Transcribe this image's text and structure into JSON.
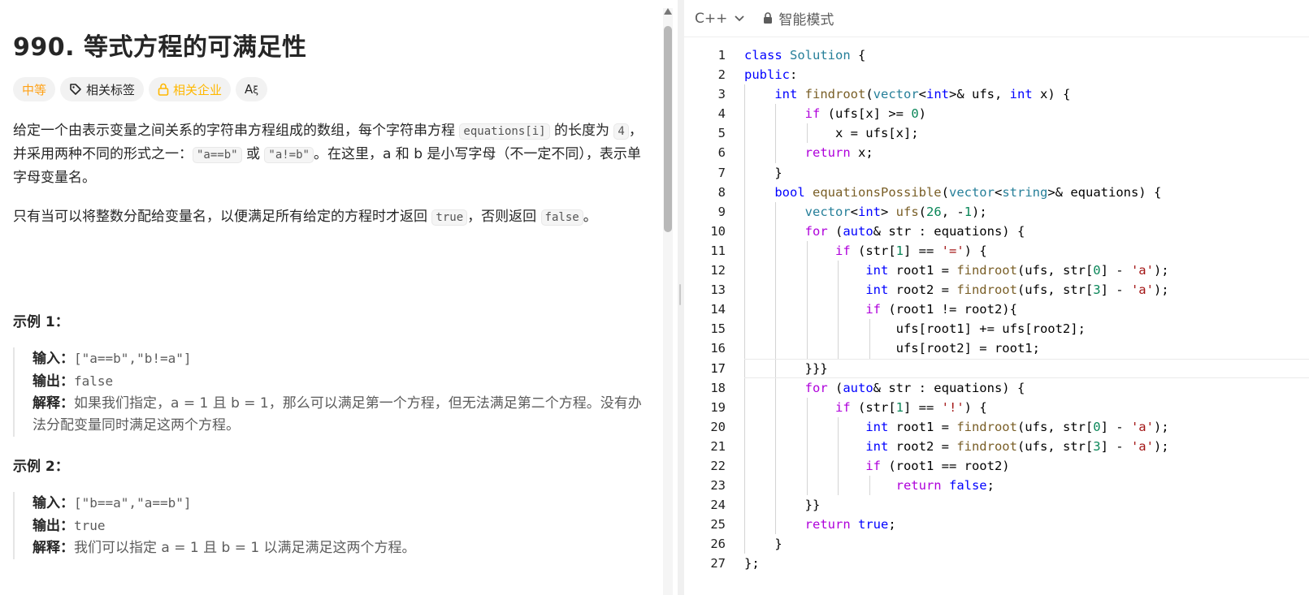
{
  "problem": {
    "title": "990. 等式方程的可满足性",
    "difficulty": "中等",
    "tag_topics": "相关标签",
    "tag_companies": "相关企业",
    "tag_translate": "A"
  },
  "description": {
    "p1_a": "给定一个由表示变量之间关系的字符串方程组成的数组，每个字符串方程 ",
    "p1_code1": "equations[i]",
    "p1_b": " 的长度为 ",
    "p1_code2": "4",
    "p1_c": "，并采用两种不同的形式之一：",
    "p1_code3": "\"a==b\"",
    "p1_d": " 或 ",
    "p1_code4": "\"a!=b\"",
    "p1_e": "。在这里，a 和 b 是小写字母（不一定不同），表示单字母变量名。",
    "p2_a": "只有当可以将整数分配给变量名，以便满足所有给定的方程时才返回 ",
    "p2_code1": "true",
    "p2_b": "，否则返回 ",
    "p2_code2": "false",
    "p2_c": "。"
  },
  "examples": [
    {
      "title": "示例 1：",
      "input_label": "输入：",
      "input": "[\"a==b\",\"b!=a\"]",
      "output_label": "输出：",
      "output": "false",
      "explain_label": "解释：",
      "explain": "如果我们指定，a = 1 且 b = 1，那么可以满足第一个方程，但无法满足第二个方程。没有办法分配变量同时满足这两个方程。"
    },
    {
      "title": "示例 2：",
      "input_label": "输入：",
      "input": "[\"b==a\",\"a==b\"]",
      "output_label": "输出：",
      "output": "true",
      "explain_label": "解释：",
      "explain": "我们可以指定 a = 1 且 b = 1 以满足满足这两个方程。"
    }
  ],
  "editor": {
    "language": "C++",
    "mode": "智能模式",
    "active_line": 17,
    "lines": [
      "class Solution {",
      "public:",
      "    int findroot(vector<int>& ufs, int x) {",
      "        if (ufs[x] >= 0)",
      "            x = ufs[x];",
      "        return x;",
      "    }",
      "    bool equationsPossible(vector<string>& equations) {",
      "        vector<int> ufs(26, -1);",
      "        for (auto& str : equations) {",
      "            if (str[1] == '=') {",
      "                int root1 = findroot(ufs, str[0] - 'a');",
      "                int root2 = findroot(ufs, str[3] - 'a');",
      "                if (root1 != root2){",
      "                    ufs[root1] += ufs[root2];",
      "                    ufs[root2] = root1;",
      "        }}}",
      "        for (auto& str : equations) {",
      "            if (str[1] == '!') {",
      "                int root1 = findroot(ufs, str[0] - 'a');",
      "                int root2 = findroot(ufs, str[3] - 'a');",
      "                if (root1 == root2)",
      "                    return false;",
      "        }}",
      "        return true;",
      "    }",
      "};"
    ]
  }
}
